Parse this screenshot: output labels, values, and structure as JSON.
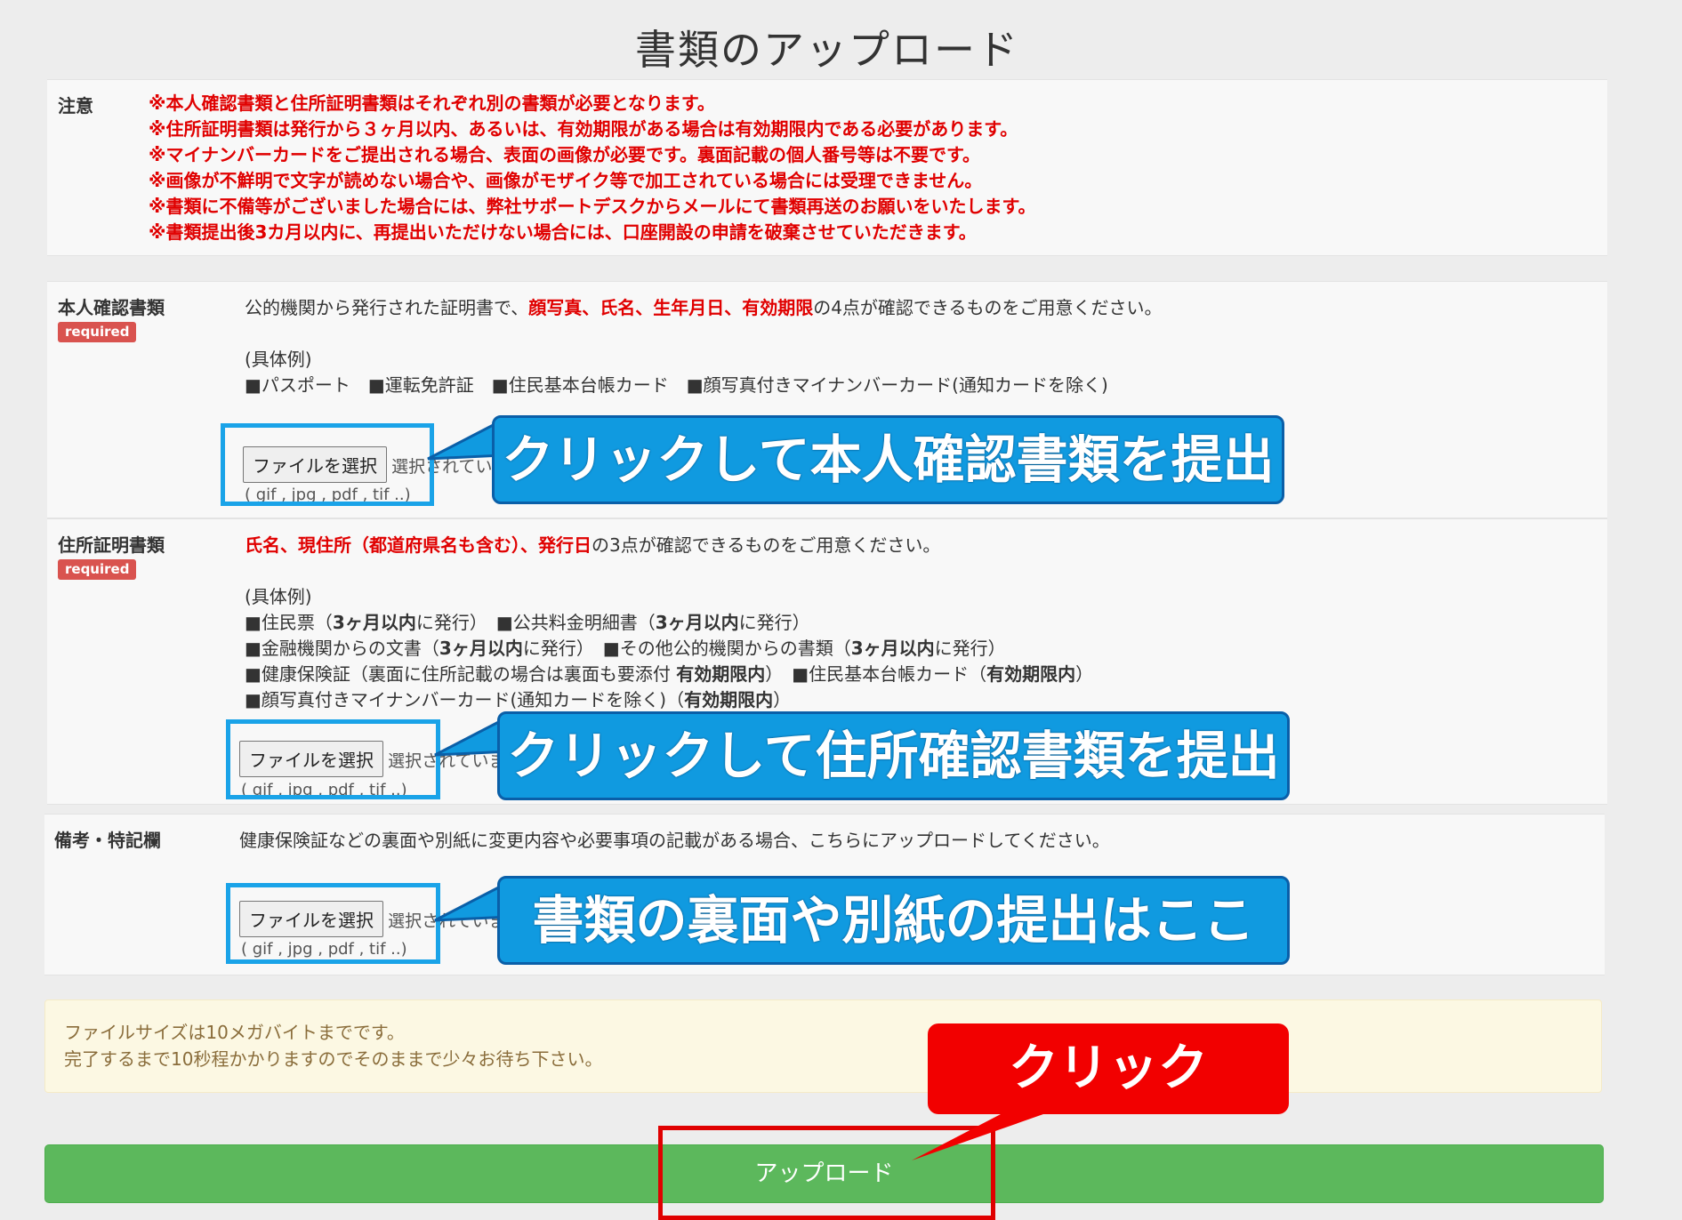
{
  "page": {
    "title": "書類のアップロード"
  },
  "notice": {
    "label": "注意",
    "lines": [
      "※本人確認書類と住所証明書類はそれぞれ別の書類が必要となります。",
      "※住所証明書類は発行から３ヶ月以内、あるいは、有効期限がある場合は有効期限内である必要があります。",
      "※マイナンバーカードをご提出される場合、表面の画像が必要です。裏面記載の個人番号等は不要です。",
      "※画像が不鮮明で文字が読めない場合や、画像がモザイク等で加工されている場合には受理できません。",
      "※書類に不備等がございました場合には、弊社サポートデスクからメールにて書類再送のお願いをいたします。",
      "※書類提出後3カ月以内に、再提出いただけない場合には、口座開設の申請を破棄させていただきます。"
    ]
  },
  "identity": {
    "label": "本人確認書類",
    "badge": "required",
    "desc_pre": "公的機関から発行された証明書で、",
    "desc_red": "顔写真、氏名、生年月日、有効期限",
    "desc_post": "の4点が確認できるものをご用意ください。",
    "examples_title": "(具体例)",
    "examples_line": "■パスポート　■運転免許証　■住民基本台帳カード　■顔写真付きマイナンバーカード(通知カードを除く)",
    "file_button": "ファイルを選択",
    "file_status": "選択されていません",
    "file_hint": "( gif , jpg , pdf , tif ..)",
    "callout": "クリックして本人確認書類を提出"
  },
  "address": {
    "label": "住所証明書類",
    "badge": "required",
    "desc_red": "氏名、現住所（都道府県名も含む）、発行日",
    "desc_post": "の3点が確認できるものをご用意ください。",
    "examples_title": "(具体例)",
    "ex1a": "■住民票（",
    "ex1b": "3ヶ月以内",
    "ex1c": "に発行）　■公共料金明細書（",
    "ex1d": "3ヶ月以内",
    "ex1e": "に発行）",
    "ex2a": "■金融機関からの文書（",
    "ex2b": "3ヶ月以内",
    "ex2c": "に発行）　■その他公的機関からの書類（",
    "ex2d": "3ヶ月以内",
    "ex2e": "に発行）",
    "ex3a": "■健康保険証（裏面に住所記載の場合は裏面も要添付 ",
    "ex3b": "有効期限内",
    "ex3c": "）　■住民基本台帳カード（",
    "ex3d": "有効期限内",
    "ex3e": "）",
    "ex4a": "■顔写真付きマイナンバーカード(通知カードを除く)（",
    "ex4b": "有効期限内",
    "ex4c": "）",
    "file_button": "ファイルを選択",
    "file_status": "選択されていません",
    "file_hint": "( gif , jpg , pdf , tif ..)",
    "callout": "クリックして住所確認書類を提出"
  },
  "remarks": {
    "label": "備考・特記欄",
    "desc": "健康保険証などの裏面や別紙に変更内容や必要事項の記載がある場合、こちらにアップロードしてください。",
    "file_button": "ファイルを選択",
    "file_status": "選択されていません",
    "file_hint": "( gif , jpg , pdf , tif ..)",
    "callout": "書類の裏面や別紙の提出はここ"
  },
  "info": {
    "line1": "ファイルサイズは10メガバイトまでです。",
    "line2": "完了するまで10秒程かかりますのでそのままで少々お待ち下さい。"
  },
  "upload": {
    "button": "アップロード",
    "callout": "クリック"
  },
  "colors": {
    "notice_red": "#e00000",
    "badge_red": "#d9534f",
    "callout_blue": "#109ae0",
    "frame_blue": "#1aa3e8",
    "upload_green": "#5cb85c",
    "info_bg": "#fcf8e3"
  }
}
